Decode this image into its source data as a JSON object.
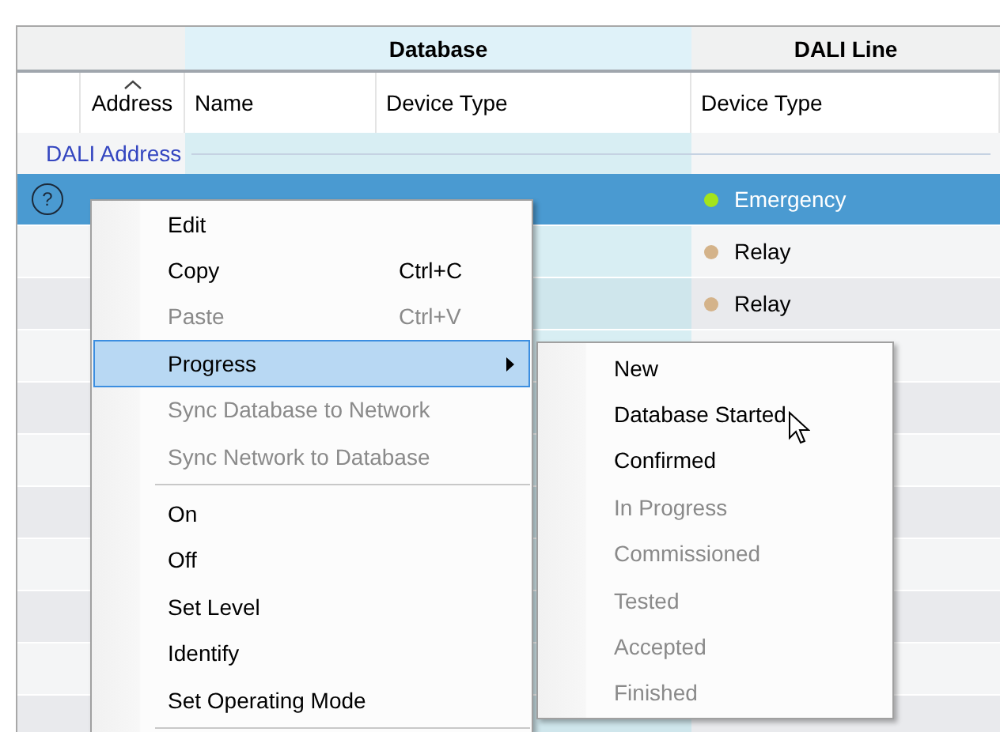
{
  "table": {
    "column_groups": [
      {
        "label": "Database"
      },
      {
        "label": "DALI Line"
      }
    ],
    "columns": [
      {
        "label": "Address",
        "sorted": true
      },
      {
        "label": "Name",
        "sorted": false
      },
      {
        "label": "Device Type",
        "sorted": false
      },
      {
        "label": "Device Type",
        "sorted": false
      }
    ],
    "group_header": "DALI Address",
    "rows": [
      {
        "selected": true,
        "status": "?",
        "line_device_type": "Emergency",
        "color": "#a4e41c"
      },
      {
        "selected": false,
        "line_device_type": "Relay",
        "color": "#d4b38a"
      },
      {
        "selected": false,
        "line_device_type": "Relay",
        "color": "#d4b38a"
      }
    ]
  },
  "context_menu": {
    "items": [
      {
        "kind": "item",
        "label": "Edit",
        "disabled": false,
        "selected": false
      },
      {
        "kind": "item",
        "label": "Copy",
        "shortcut": "Ctrl+C",
        "disabled": false,
        "selected": false
      },
      {
        "kind": "item",
        "label": "Paste",
        "shortcut": "Ctrl+V",
        "disabled": true,
        "selected": false
      },
      {
        "kind": "submenu",
        "label": "Progress",
        "disabled": false,
        "selected": true
      },
      {
        "kind": "item",
        "label": "Sync Database to Network",
        "disabled": true,
        "selected": false
      },
      {
        "kind": "item",
        "label": "Sync Network to Database",
        "disabled": true,
        "selected": false
      },
      {
        "kind": "separator"
      },
      {
        "kind": "item",
        "label": "On",
        "disabled": false,
        "selected": false
      },
      {
        "kind": "item",
        "label": "Off",
        "disabled": false,
        "selected": false
      },
      {
        "kind": "item",
        "label": "Set Level",
        "disabled": false,
        "selected": false
      },
      {
        "kind": "item",
        "label": "Identify",
        "disabled": false,
        "selected": false
      },
      {
        "kind": "item",
        "label": "Set Operating Mode",
        "disabled": false,
        "selected": false
      },
      {
        "kind": "separator"
      }
    ]
  },
  "submenu": {
    "items": [
      {
        "kind": "item",
        "label": "New",
        "disabled": false,
        "selected": false
      },
      {
        "kind": "item",
        "label": "Database Started",
        "disabled": false,
        "selected": false
      },
      {
        "kind": "item",
        "label": "Confirmed",
        "disabled": false,
        "selected": false
      },
      {
        "kind": "item",
        "label": "In Progress",
        "disabled": true,
        "selected": false
      },
      {
        "kind": "item",
        "label": "Commissioned",
        "disabled": true,
        "selected": false
      },
      {
        "kind": "item",
        "label": "Tested",
        "disabled": true,
        "selected": false
      },
      {
        "kind": "item",
        "label": "Accepted",
        "disabled": true,
        "selected": false
      },
      {
        "kind": "item",
        "label": "Finished",
        "disabled": true,
        "selected": false
      }
    ]
  }
}
